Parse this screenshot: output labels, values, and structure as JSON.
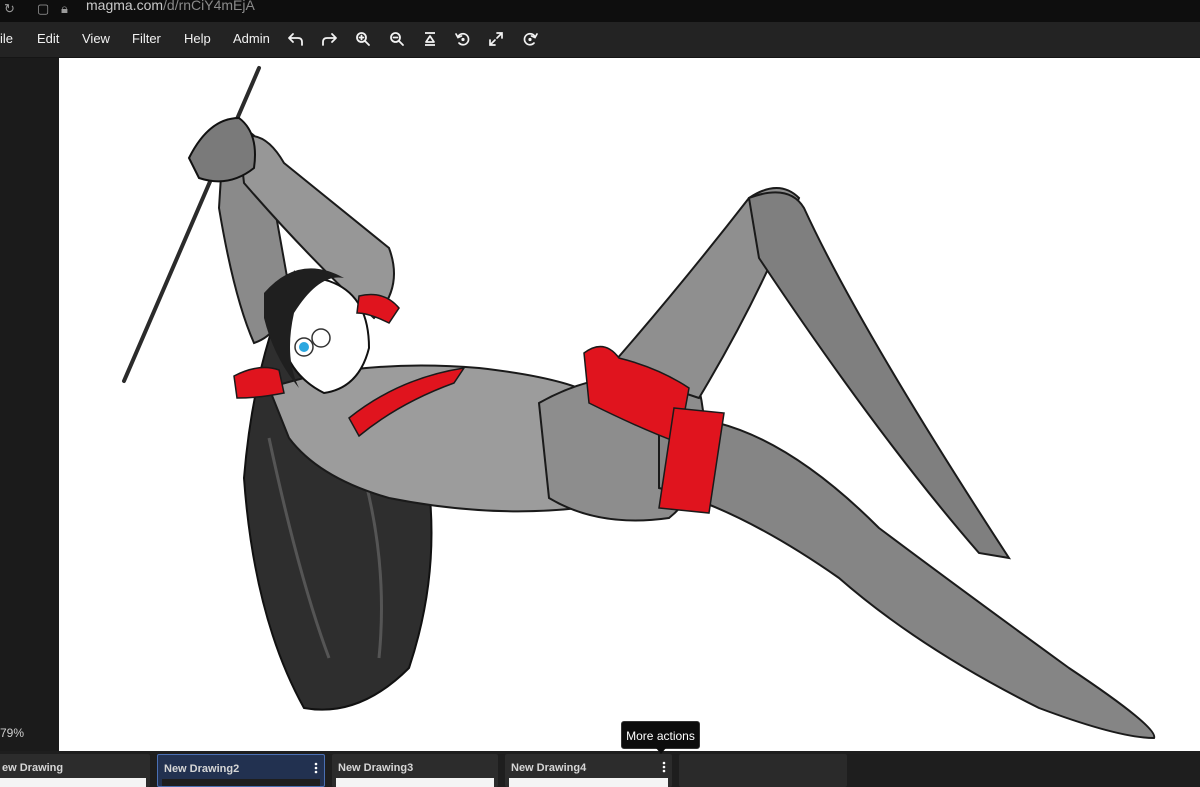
{
  "browser": {
    "url_host": "magma.com",
    "url_path": "/d/rnCiY4mEjA"
  },
  "menu": {
    "file": "ile",
    "edit": "Edit",
    "view": "View",
    "filter": "Filter",
    "help": "Help",
    "admin": "Admin"
  },
  "toolbar_icons": [
    "undo-icon",
    "redo-icon",
    "zoom-in-icon",
    "zoom-out-icon",
    "fit-icon",
    "rotate-left-icon",
    "fullscreen-icon",
    "rotate-right-icon"
  ],
  "status": {
    "zoom": "79%"
  },
  "tabs": [
    {
      "title": "ew Drawing",
      "active": false
    },
    {
      "title": "New Drawing2",
      "active": true
    },
    {
      "title": "New Drawing3",
      "active": false
    },
    {
      "title": "New Drawing4",
      "active": false
    }
  ],
  "tooltip": {
    "text": "More actions"
  },
  "colors": {
    "accent": "#4a6fb3",
    "armor_red": "#e0141e",
    "menubar": "#232323"
  }
}
